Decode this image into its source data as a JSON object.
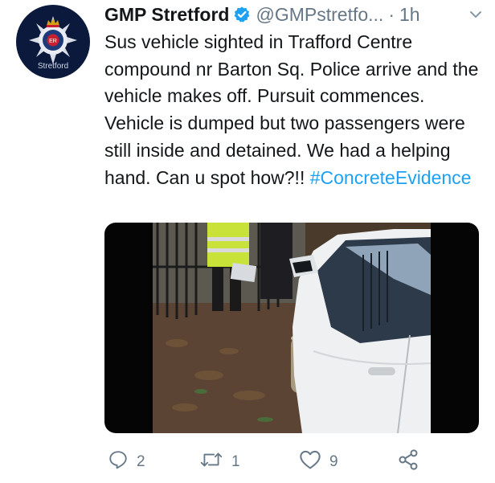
{
  "account": {
    "display_name": "GMP Stretford",
    "handle": "@GMPstretfo...",
    "separator": "·",
    "time": "1h",
    "avatar_caption": "Stretford"
  },
  "tweet": {
    "text": "Sus vehicle sighted in Trafford Centre compound nr Barton Sq. Police arrive and the vehicle makes off. Pursuit commences. Vehicle is dumped but two passengers were still inside and detained. We had a helping hand. Can u spot how?!!",
    "hashtag": "#ConcreteEvidence"
  },
  "actions": {
    "reply_count": "2",
    "retweet_count": "1",
    "like_count": "9"
  },
  "icons": {
    "verified": "verified-badge-icon",
    "chevron": "chevron-down-icon",
    "reply": "reply-icon",
    "retweet": "retweet-icon",
    "like": "heart-icon",
    "share": "share-icon"
  },
  "colors": {
    "link": "#1da1f2",
    "muted": "#657786",
    "text": "#14171a",
    "avatar_bg": "#0b1a3c"
  }
}
